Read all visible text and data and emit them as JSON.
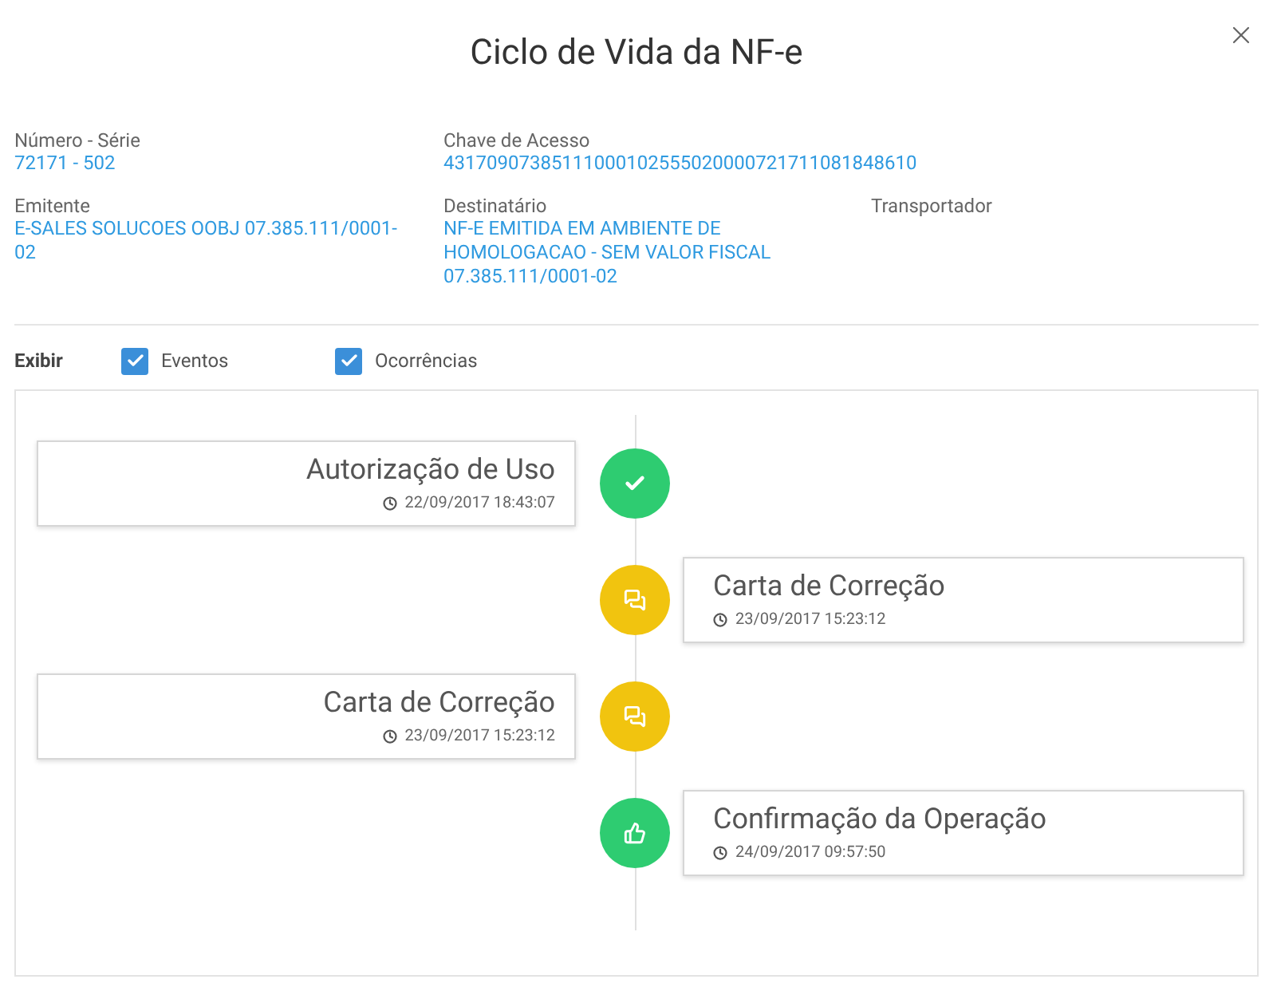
{
  "title": "Ciclo de Vida da NF-e",
  "fields": [
    {
      "label": "Número - Série",
      "value": "72171 - 502"
    },
    {
      "label": "Chave de Acesso",
      "value": "43170907385111000102555020000721711081848610"
    },
    {
      "label": "Emitente",
      "value": "E-SALES SOLUCOES OOBJ 07.385.111/0001-02"
    },
    {
      "label": "Destinatário",
      "value": "NF-E EMITIDA EM AMBIENTE DE HOMOLOGACAO - SEM VALOR FISCAL 07.385.111/0001-02"
    },
    {
      "label": "Transportador"
    }
  ],
  "filter": {
    "label": "Exibir",
    "options": [
      {
        "label": "Eventos",
        "checked": true
      },
      {
        "label": "Ocorrências",
        "checked": true
      }
    ]
  },
  "timeline": [
    {
      "on_right": false,
      "kind": "check",
      "color": "#2ecc71",
      "title": "Autorização de Uso",
      "time": "22/09/2017 18:43:07"
    },
    {
      "on_right": true,
      "kind": "chat",
      "color": "#f1c40f",
      "title": "Carta de Correção",
      "time": "23/09/2017 15:23:12"
    },
    {
      "on_right": false,
      "kind": "chat",
      "color": "#f1c40f",
      "title": "Carta de Correção",
      "time": "23/09/2017 15:23:12"
    },
    {
      "on_right": true,
      "kind": "thumb",
      "color": "#2ecc71",
      "title": "Confirmação da Operação",
      "time": "24/09/2017 09:57:50"
    }
  ]
}
